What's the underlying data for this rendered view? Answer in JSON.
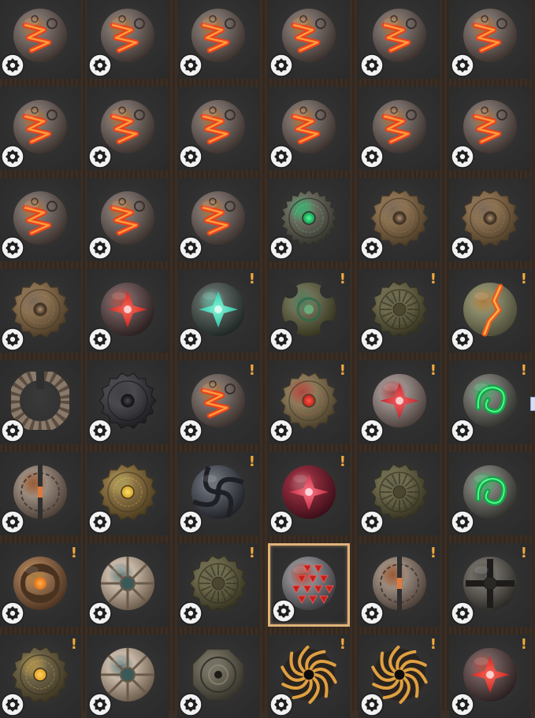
{
  "inventory": {
    "rows": 8,
    "columns": 6,
    "selected_index": 39,
    "alert_text": "!",
    "badge_icon": "gear-icon",
    "colors": {
      "selection_border": "#e0b37a",
      "alert": "#f2a93b",
      "cell_bg": "#2f2f2f",
      "divider": "#3a2f26"
    },
    "items": [
      {
        "type": "lava-orb",
        "alert": false
      },
      {
        "type": "lava-orb",
        "alert": false
      },
      {
        "type": "lava-orb",
        "alert": false
      },
      {
        "type": "lava-orb",
        "alert": false
      },
      {
        "type": "lava-orb",
        "alert": false
      },
      {
        "type": "lava-orb",
        "alert": false
      },
      {
        "type": "lava-orb",
        "alert": false
      },
      {
        "type": "lava-orb",
        "alert": false
      },
      {
        "type": "lava-orb",
        "alert": false
      },
      {
        "type": "lava-orb",
        "alert": false
      },
      {
        "type": "lava-orb",
        "alert": false
      },
      {
        "type": "lava-orb",
        "alert": false
      },
      {
        "type": "lava-orb",
        "alert": false
      },
      {
        "type": "lava-orb",
        "alert": false
      },
      {
        "type": "lava-orb",
        "alert": false
      },
      {
        "type": "green-rune-disc",
        "alert": false
      },
      {
        "type": "bronze-cog",
        "alert": false
      },
      {
        "type": "bronze-cog",
        "alert": false
      },
      {
        "type": "bronze-cog",
        "alert": false
      },
      {
        "type": "red-crystal-orb",
        "alert": false
      },
      {
        "type": "teal-burst-orb",
        "alert": true
      },
      {
        "type": "green-cross-disc",
        "alert": true
      },
      {
        "type": "olive-sun-disc",
        "alert": true
      },
      {
        "type": "lava-vein-orb",
        "alert": true
      },
      {
        "type": "cracked-ring",
        "alert": false
      },
      {
        "type": "dark-cog",
        "alert": false
      },
      {
        "type": "lava-orb",
        "alert": true
      },
      {
        "type": "ruby-cog",
        "alert": true
      },
      {
        "type": "cracked-ruby-orb",
        "alert": true
      },
      {
        "type": "green-swirl-orb",
        "alert": true
      },
      {
        "type": "split-stone-disc",
        "alert": false
      },
      {
        "type": "gold-cog",
        "alert": false
      },
      {
        "type": "steel-swirl",
        "alert": true
      },
      {
        "type": "crimson-shard-orb",
        "alert": true
      },
      {
        "type": "olive-sun-disc",
        "alert": false
      },
      {
        "type": "green-swirl-orb",
        "alert": false
      },
      {
        "type": "amber-knot-orb",
        "alert": true
      },
      {
        "type": "shattered-eye-orb",
        "alert": false
      },
      {
        "type": "olive-sun-disc",
        "alert": true
      },
      {
        "type": "red-faceted-orb",
        "alert": false
      },
      {
        "type": "split-stone-disc",
        "alert": true
      },
      {
        "type": "iron-cross-orb",
        "alert": true
      },
      {
        "type": "gold-gem-cog",
        "alert": true
      },
      {
        "type": "shattered-eye-orb",
        "alert": false
      },
      {
        "type": "octagon-plate",
        "alert": false
      },
      {
        "type": "bone-spiral",
        "alert": true
      },
      {
        "type": "bone-spiral",
        "alert": true
      },
      {
        "type": "red-crystal-orb",
        "alert": true
      }
    ]
  }
}
